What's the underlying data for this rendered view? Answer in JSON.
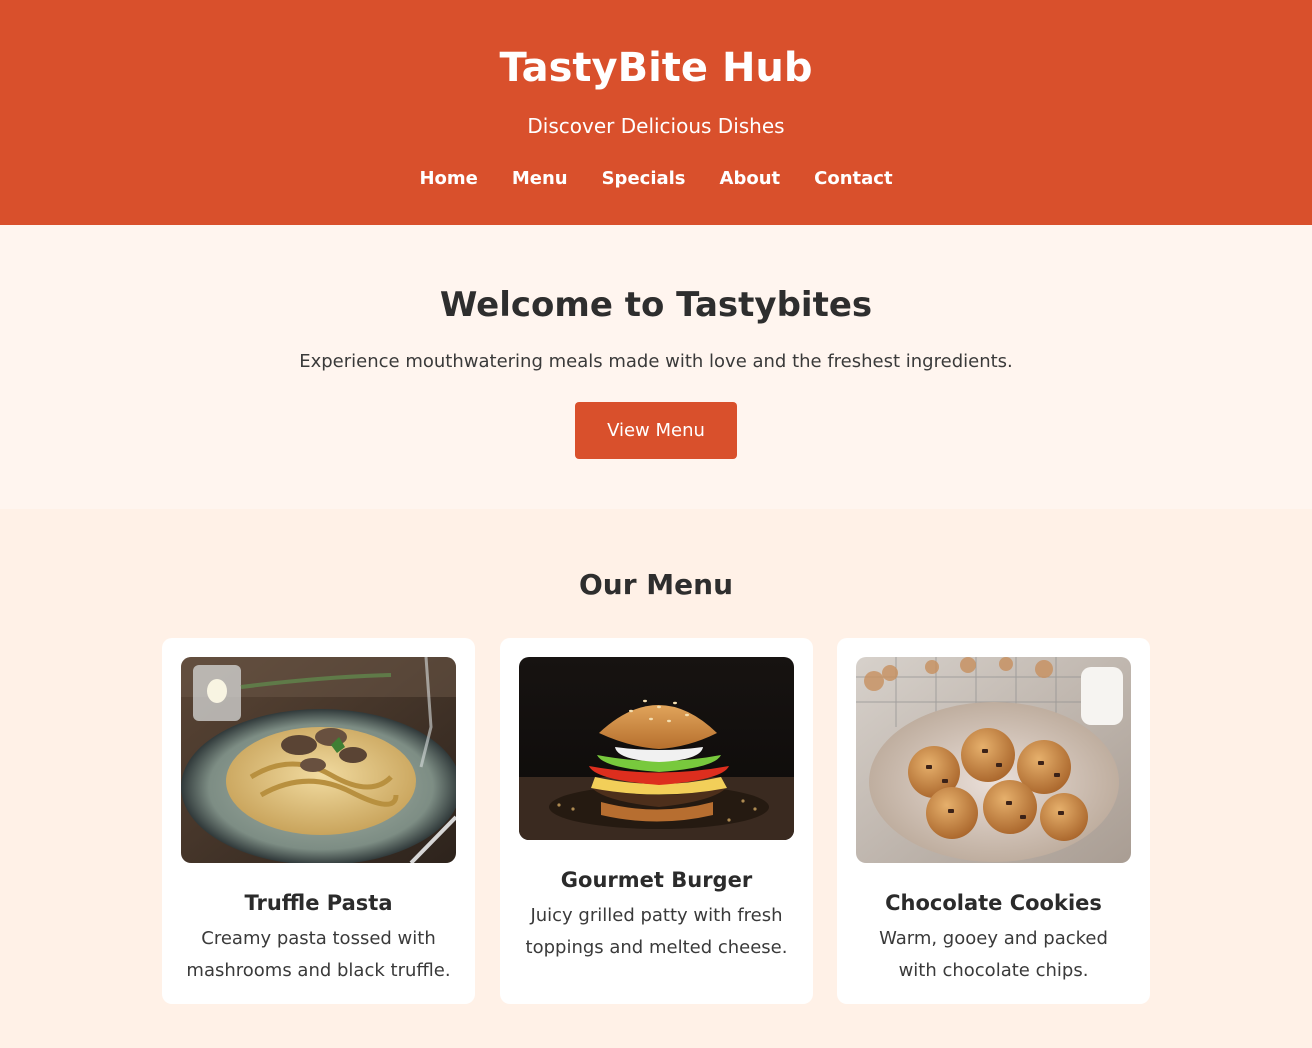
{
  "header": {
    "brand": "TastyBite Hub",
    "tagline": "Discover Delicious Dishes",
    "nav": [
      "Home",
      "Menu",
      "Specials",
      "About",
      "Contact"
    ]
  },
  "hero": {
    "title": "Welcome to Tastybites",
    "text": "Experience mouthwatering meals made with love and the freshest ingredients.",
    "button": "View Menu"
  },
  "menu": {
    "title": "Our Menu",
    "items": [
      {
        "name": "Truffle Pasta",
        "description": "Creamy pasta tossed with mashrooms and black truffle."
      },
      {
        "name": "Gourmet Burger",
        "description": "Juicy grilled patty with fresh toppings and melted cheese."
      },
      {
        "name": "Chocolate Cookies",
        "description": "Warm, gooey and packed with chocolate chips."
      }
    ]
  },
  "colors": {
    "primary": "#d9502c",
    "hero_bg": "#fff5ef",
    "section_bg": "#fff1e7",
    "card_bg": "#ffffff",
    "text": "#333333"
  }
}
